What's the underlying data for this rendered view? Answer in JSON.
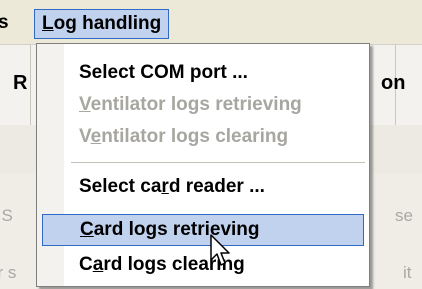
{
  "menubar": {
    "partial_label": "s",
    "active_menu": {
      "mnemonic": "L",
      "rest": "og handling"
    }
  },
  "background": {
    "left_heading": "R",
    "right_heading": "on",
    "left_faint_1": "t S",
    "left_faint_2": "er s",
    "right_faint_1": "se",
    "right_faint_2": "it"
  },
  "menu": {
    "items": [
      {
        "before": "Select COM port ...",
        "mnemonic": "",
        "after": "",
        "state": "enabled"
      },
      {
        "before": "",
        "mnemonic": "V",
        "after": "entilator logs retrieving",
        "state": "disabled"
      },
      {
        "before": "V",
        "mnemonic": "e",
        "after": "ntilator logs clearing",
        "state": "disabled"
      },
      {
        "before": "Select ca",
        "mnemonic": "r",
        "after": "d reader ...",
        "state": "enabled"
      },
      {
        "before": "",
        "mnemonic": "C",
        "after": "ard logs retrieving",
        "state": "highlighted"
      },
      {
        "before": "C",
        "mnemonic": "a",
        "after": "rd logs clearing",
        "state": "enabled"
      }
    ]
  },
  "colors": {
    "highlight_bg": "#c1d2ee",
    "highlight_border": "#316ac5",
    "disabled_text": "#a7a6a0"
  },
  "icons": {
    "cursor": "arrow-pointer-icon"
  }
}
